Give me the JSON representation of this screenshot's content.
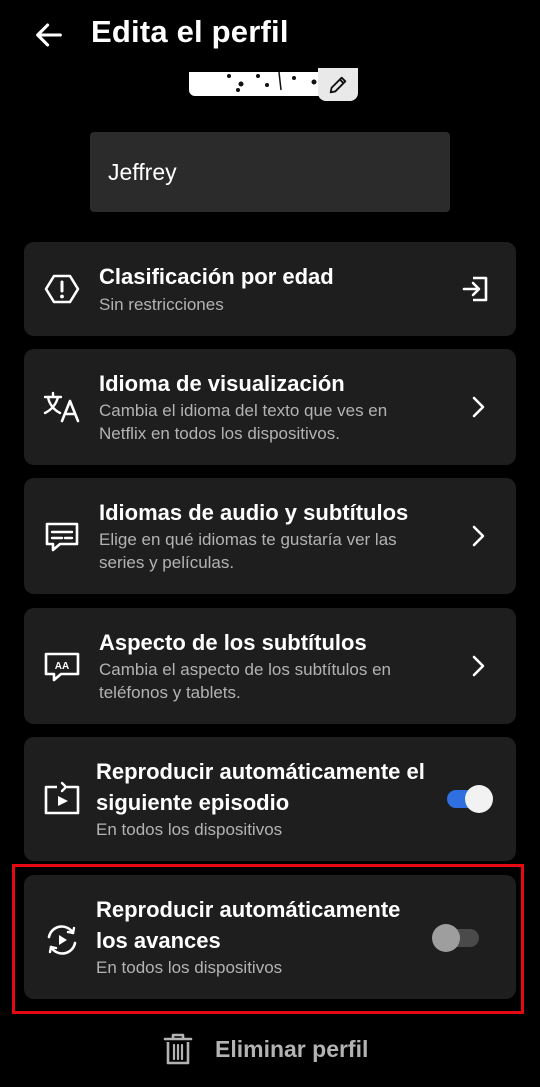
{
  "header": {
    "title": "Edita el perfil"
  },
  "profile": {
    "name": "Jeffrey"
  },
  "settings": [
    {
      "title": "Clasificación por edad",
      "subtitle": "Sin restricciones"
    },
    {
      "title": "Idioma de visualización",
      "subtitle": "Cambia el idioma del texto que ves en Netflix en todos los dispositivos."
    },
    {
      "title": "Idiomas de audio y subtítulos",
      "subtitle": "Elige en qué idiomas te gustaría ver las series y películas."
    },
    {
      "title": "Aspecto de los subtítulos",
      "subtitle": "Cambia el aspecto de los subtítulos en teléfonos y tablets."
    },
    {
      "title": "Reproducir automáticamente el siguiente episodio",
      "subtitle": "En todos los dispositivos",
      "enabled": true
    },
    {
      "title": "Reproducir automáticamente los avances",
      "subtitle": "En todos los dispositivos",
      "enabled": false
    }
  ],
  "delete": {
    "label": "Eliminar perfil"
  },
  "colors": {
    "accent": "#2f6fe0",
    "highlight": "#e50914",
    "card": "#1e1e1e"
  }
}
